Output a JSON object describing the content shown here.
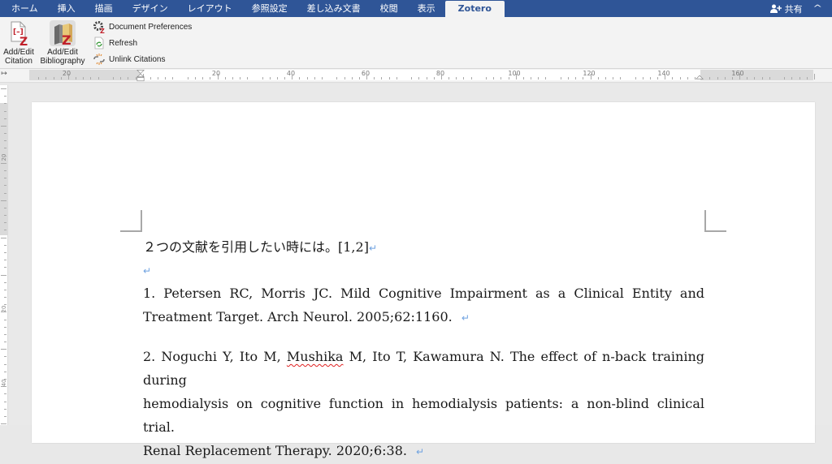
{
  "tabs": [
    {
      "label": "ホーム",
      "active": false
    },
    {
      "label": "挿入",
      "active": false
    },
    {
      "label": "描画",
      "active": false
    },
    {
      "label": "デザイン",
      "active": false
    },
    {
      "label": "レイアウト",
      "active": false
    },
    {
      "label": "参照設定",
      "active": false
    },
    {
      "label": "差し込み文書",
      "active": false
    },
    {
      "label": "校閲",
      "active": false
    },
    {
      "label": "表示",
      "active": false
    },
    {
      "label": "Zotero",
      "active": true
    }
  ],
  "tabbar_right": {
    "share_label": "共有",
    "share_icon": "add-person-icon",
    "collapse_icon": "chevron-up-icon"
  },
  "ribbon": {
    "add_edit_citation": {
      "line1": "Add/Edit",
      "line2": "Citation",
      "icon": "zotero-citation-icon"
    },
    "add_edit_bibliography": {
      "line1": "Add/Edit",
      "line2": "Bibliography",
      "icon": "zotero-bibliography-icon"
    },
    "document_preferences": {
      "label": "Document Preferences",
      "icon": "gear-icon"
    },
    "refresh": {
      "label": "Refresh",
      "icon": "refresh-icon"
    },
    "unlink_citations": {
      "label": "Unlink Citations",
      "icon": "unlink-icon"
    }
  },
  "colors": {
    "tabbar_bg": "#2f5597",
    "ribbon_bg": "#f3f3f3",
    "zotero_red": "#c0202a",
    "paragraph_mark": "#6fa2e0",
    "spellcheck_underline": "#e02020"
  },
  "ruler": {
    "horizontal_labels": [
      "20",
      "20",
      "40",
      "60",
      "80",
      "100",
      "120",
      "140",
      "160"
    ],
    "vertical_labels": [
      "20",
      "20",
      "40"
    ]
  },
  "document": {
    "intro_text": "２つの文献を引用したい時には。[1,2]",
    "references": [
      {
        "line1": "1. Petersen RC, Morris JC. Mild Cognitive Impairment as a Clinical Entity and",
        "line2": "Treatment Target. Arch Neurol. 2005;62:1160."
      },
      {
        "pre": "2. Noguchi Y, Ito M, ",
        "misspelled": "Mushika",
        "post": " M, Ito T, Kawamura N. The effect of n-back training during",
        "line2": "hemodialysis on cognitive function in hemodialysis patients: a non-blind clinical trial.",
        "line3": "Renal Replacement Therapy. 2020;6:38."
      }
    ],
    "paragraph_mark": "↵"
  }
}
